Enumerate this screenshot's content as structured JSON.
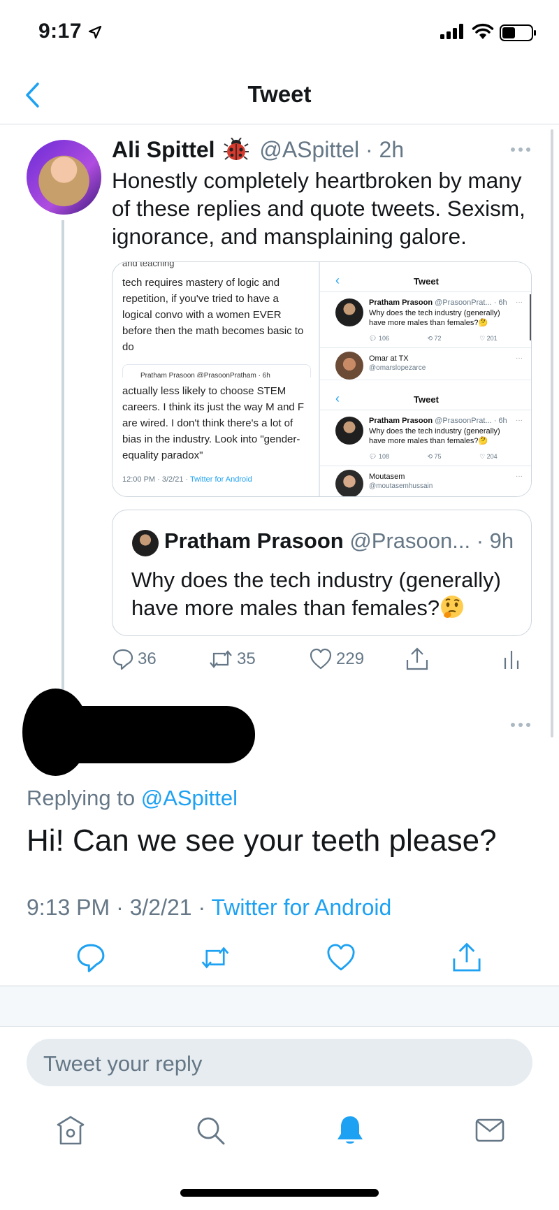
{
  "status_bar": {
    "time": "9:17"
  },
  "nav": {
    "title": "Tweet"
  },
  "tweet": {
    "name": "Ali Spittel",
    "handle": "@ASpittel",
    "time": "· 2h",
    "text": "Honestly completely heartbroken by many of these replies and quote tweets. Sexism, ignorance, and mansplaining galore.",
    "media": {
      "left": {
        "crop_text": "and teaching",
        "text1": "tech requires mastery of logic and repetition, if you've tried to have a logical convo with a women EVER before then the math becomes basic to do",
        "card_name": "Pratham Prasoon @PrasoonPratham · 6h",
        "text2": "actually less likely to choose STEM careers. I think its just the way M and F are wired. I don't think there's a lot of bias in the industry. Look into \"gender-equality paradox\"",
        "footer_time": "12:00 PM · 3/2/21 · ",
        "footer_source": "Twitter for Android"
      },
      "right": {
        "title": "Tweet",
        "name": "Pratham Prasoon",
        "handle_time": "@PrasoonPrat... · 6h",
        "body": "Why does the tech industry (generally) have more males than females?🤔",
        "panel1": {
          "replies": "106",
          "retweets": "72",
          "likes": "201",
          "next_name": "Omar at TX",
          "next_handle": "@omarslopezarce"
        },
        "panel2": {
          "replies": "108",
          "retweets": "75",
          "likes": "204",
          "next_name": "Moutasem",
          "next_handle": "@moutasemhussain"
        }
      }
    },
    "quote": {
      "name": "Pratham Prasoon",
      "handle": "@Prasoon...",
      "time": "· 9h",
      "text": "Why does the tech industry (generally) have more males than females?"
    },
    "actions": {
      "replies": "36",
      "retweets": "35",
      "likes": "229"
    }
  },
  "reply": {
    "replying_prefix": "Replying to ",
    "replying_to": "@ASpittel",
    "text": "Hi!  Can we see your teeth please?",
    "meta_time": "9:13 PM · 3/2/21 · ",
    "meta_source": "Twitter for Android"
  },
  "compose": {
    "placeholder": "Tweet your reply"
  },
  "colors": {
    "accent": "#1da1f2",
    "secondary_text": "#657786",
    "border": "#ccd6dd"
  },
  "icons": {
    "tabbar": [
      "home-icon",
      "search-icon",
      "notifications-icon",
      "messages-icon"
    ],
    "actions": [
      "reply-icon",
      "retweet-icon",
      "like-icon",
      "share-icon",
      "analytics-icon"
    ]
  }
}
